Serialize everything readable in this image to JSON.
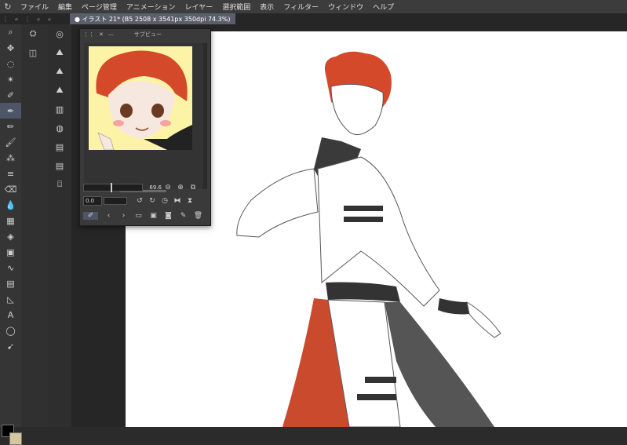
{
  "menu": [
    "ファイル",
    "編集",
    "ページ管理",
    "アニメーション",
    "レイヤー",
    "選択範囲",
    "表示",
    "フィルター",
    "ウィンドウ",
    "ヘルプ"
  ],
  "document_tab": "イラスト 21* (B5 2508 x 3541px 350dpi 74.3%)",
  "subview": {
    "title": "サブビュー",
    "zoom_value": "69.6",
    "rotation_value": "0.0"
  },
  "colors": {
    "main_color": "#000000",
    "sub_color": "#d4c7a0",
    "hair": "#d3492a"
  }
}
